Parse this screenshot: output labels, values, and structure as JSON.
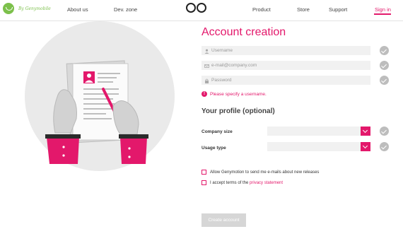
{
  "header": {
    "logo_text": "By Genymobile",
    "nav": {
      "about": "About us",
      "dev_zone": "Dev. zone",
      "product": "Product",
      "store": "Store",
      "support": "Support",
      "signin": "Sign in"
    }
  },
  "form": {
    "title": "Account creation",
    "username_placeholder": "Username",
    "email_placeholder": "e-mail@company.com",
    "password_placeholder": "Password",
    "error": "Please specify a username.",
    "profile_title": "Your profile (optional)",
    "company_size_label": "Company size",
    "usage_type_label": "Usage type",
    "newsletter_label": "Allow Genymotion to send me e-mails about new releases",
    "terms_prefix": "I accept terms of the ",
    "terms_link": "privacy statement",
    "submit_label": "Create account"
  },
  "colors": {
    "accent": "#e3186b",
    "logo_green": "#7cc04b",
    "check_gray": "#bdbdbd",
    "field_bg": "#f1f1f1"
  },
  "icons": {
    "logo": "genymobile-logo-icon",
    "user": "user-icon",
    "mail": "mail-icon",
    "lock": "lock-icon",
    "check": "check-icon",
    "error": "error-icon",
    "dropdown": "chevron-down-icon"
  }
}
